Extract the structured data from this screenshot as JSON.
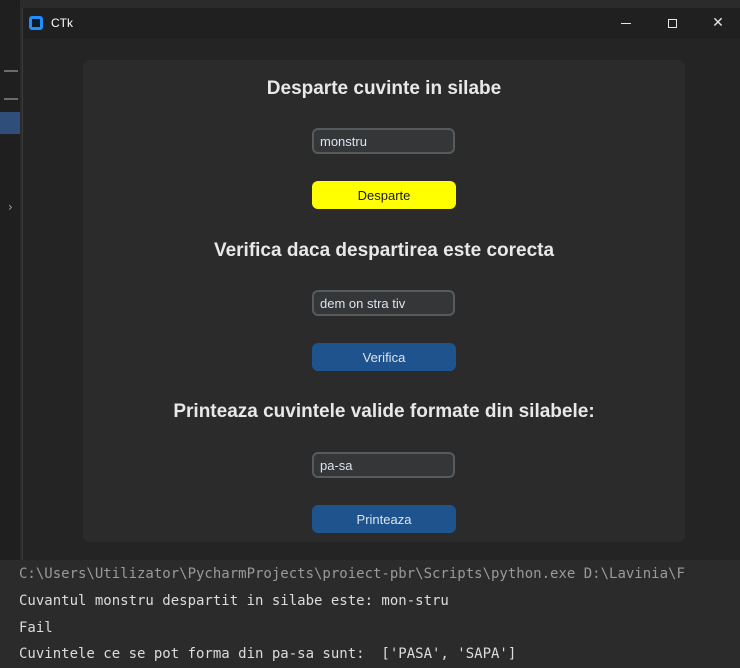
{
  "window": {
    "title": "CTk"
  },
  "app": {
    "split_heading": "Desparte cuvinte in silabe",
    "split_input_value": "monstru",
    "split_button": "Desparte",
    "verify_heading": "Verifica daca despartirea este corecta",
    "verify_input_value": "dem on stra tiv",
    "verify_button": "Verifica",
    "print_heading": "Printeaza cuvintele valide formate din silabele:",
    "print_input_value": "pa-sa",
    "print_button": "Printeaza",
    "colors": {
      "yellow_button": "#ffff00",
      "blue_button": "#1f538d"
    }
  },
  "console": {
    "lines": [
      "C:\\Users\\Utilizator\\PycharmProjects\\proiect-pbr\\Scripts\\python.exe D:\\Lavinia\\F",
      "Cuvantul monstru despartit in silabe este: mon-stru",
      "Fail",
      "Cuvintele ce se pot forma din pa-sa sunt:  ['PASA', 'SAPA']"
    ]
  }
}
